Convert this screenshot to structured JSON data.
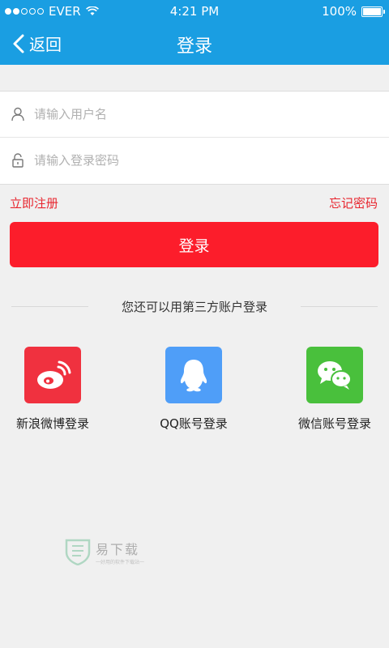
{
  "status_bar": {
    "carrier": "EVER",
    "time": "4:21 PM",
    "battery": "100%"
  },
  "nav": {
    "back_label": "返回",
    "title": "登录"
  },
  "form": {
    "username_placeholder": "请输入用户名",
    "password_placeholder": "请输入登录密码"
  },
  "links": {
    "register": "立即注册",
    "forgot": "忘记密码"
  },
  "login_button": "登录",
  "third_party": {
    "title": "您还可以用第三方账户登录",
    "items": [
      {
        "label": "新浪微博登录",
        "icon": "weibo-icon",
        "color": "#f0313f"
      },
      {
        "label": "QQ账号登录",
        "icon": "qq-icon",
        "color": "#4f9ef8"
      },
      {
        "label": "微信账号登录",
        "icon": "wechat-icon",
        "color": "#49c03c"
      }
    ]
  },
  "watermark": {
    "text": "易下载",
    "subtext": "一好用的软件下载站一"
  },
  "colors": {
    "header": "#1a9ee2",
    "accent": "#fc1d2b",
    "link": "#e8262f"
  }
}
